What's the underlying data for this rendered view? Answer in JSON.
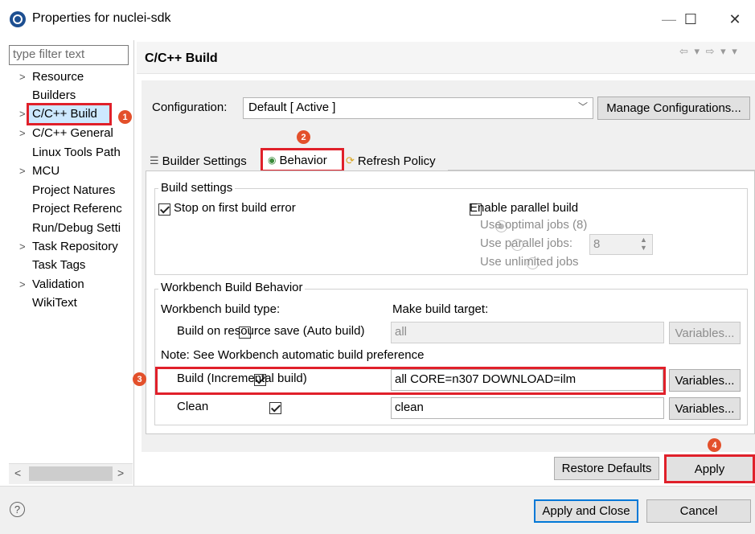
{
  "window": {
    "title": "Properties for nuclei-sdk",
    "controls": {
      "minimize": "—",
      "maximize": "☐",
      "close": "✕"
    }
  },
  "left_panel": {
    "filter_placeholder": "type filter text",
    "items": [
      {
        "label": "Resource",
        "expandable": true
      },
      {
        "label": "Builders",
        "expandable": false
      },
      {
        "label": "C/C++ Build",
        "expandable": true,
        "selected": true
      },
      {
        "label": "C/C++ General",
        "expandable": true
      },
      {
        "label": "Linux Tools Path",
        "expandable": false
      },
      {
        "label": "MCU",
        "expandable": true
      },
      {
        "label": "Project Natures",
        "expandable": false
      },
      {
        "label": "Project Referenc",
        "expandable": false
      },
      {
        "label": "Run/Debug Setti",
        "expandable": false
      },
      {
        "label": "Task Repository",
        "expandable": true
      },
      {
        "label": "Task Tags",
        "expandable": false
      },
      {
        "label": "Validation",
        "expandable": true
      },
      {
        "label": "WikiText",
        "expandable": false
      }
    ],
    "scroll_left": "<",
    "scroll_right": ">"
  },
  "page": {
    "title": "C/C++ Build",
    "configuration_label": "Configuration:",
    "configuration_value": "Default  [ Active ]",
    "manage_button": "Manage Configurations...",
    "tabs": [
      {
        "label": "Builder Settings",
        "icon": "list-icon"
      },
      {
        "label": "Behavior",
        "icon": "radio-dot-icon",
        "selected": true
      },
      {
        "label": "Refresh Policy",
        "icon": "refresh-icon"
      }
    ]
  },
  "build_settings": {
    "title": "Build settings",
    "stop_on_error": {
      "label": "Stop on first build error",
      "checked": true
    },
    "parallel": {
      "label": "Enable parallel build",
      "checked": false
    },
    "optimal": {
      "label": "Use optimal jobs (8)",
      "selected": true
    },
    "parallel_jobs": {
      "label": "Use parallel jobs:",
      "value": "8"
    },
    "unlimited": {
      "label": "Use unlimited jobs"
    }
  },
  "workbench": {
    "title": "Workbench Build Behavior",
    "type_header": "Workbench build type:",
    "target_header": "Make build target:",
    "auto_build": {
      "label": "Build on resource save (Auto build)",
      "checked": false,
      "target": "all",
      "button": "Variables..."
    },
    "note": "Note: See Workbench automatic build preference",
    "incremental": {
      "label": "Build (Incremental build)",
      "checked": true,
      "target": "all CORE=n307 DOWNLOAD=ilm",
      "button": "Variables..."
    },
    "clean": {
      "label": "Clean",
      "checked": true,
      "target": "clean",
      "button": "Variables..."
    }
  },
  "page_buttons": {
    "restore": "Restore Defaults",
    "apply": "Apply"
  },
  "dialog_buttons": {
    "help": "?",
    "apply_close": "Apply and Close",
    "cancel": "Cancel"
  },
  "annotations": [
    "1",
    "2",
    "3",
    "4"
  ],
  "colors": {
    "highlight_red": "#e0202a",
    "badge_orange": "#e3502b",
    "selection_blue": "#cde8ff"
  }
}
